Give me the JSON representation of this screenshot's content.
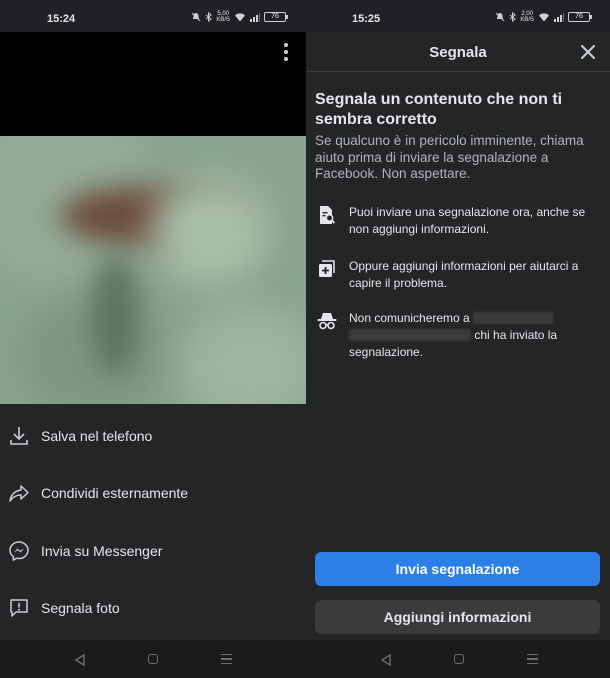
{
  "left": {
    "status_time": "15:24",
    "net_speed_value": "5,00",
    "net_speed_unit": "KB/S",
    "battery": "76",
    "menu": [
      {
        "label": "Salva nel telefono",
        "icon": "download-icon"
      },
      {
        "label": "Condividi esternamente",
        "icon": "share-icon"
      },
      {
        "label": "Invia su Messenger",
        "icon": "messenger-icon"
      },
      {
        "label": "Segnala foto",
        "icon": "report-icon"
      }
    ]
  },
  "right": {
    "status_time": "15:25",
    "net_speed_value": "2,00",
    "net_speed_unit": "KB/S",
    "battery": "76",
    "title": "Segnala",
    "heading": "Segnala un contenuto che non ti sembra corretto",
    "subtext": "Se qualcuno è in pericolo imminente, chiama aiuto prima di inviare la segnalazione a Facebook. Non aspettare.",
    "info": [
      {
        "icon": "document-search-icon",
        "text": "Puoi inviare una segnalazione ora, anche se non aggiungi informazioni."
      },
      {
        "icon": "add-info-icon",
        "text": "Oppure aggiungi informazioni per aiutarci a capire il problema."
      },
      {
        "icon": "incognito-icon",
        "text_before": "Non comunicheremo a",
        "text_after": "chi ha inviato la segnalazione."
      }
    ],
    "primary_button": "Invia segnalazione",
    "secondary_button": "Aggiungi informazioni"
  },
  "colors": {
    "background": "#242526",
    "primary_blue": "#2d7fe8",
    "secondary_button": "#3a3b3c",
    "text_primary": "#e4e6eb",
    "text_secondary": "#b0b3b8"
  }
}
